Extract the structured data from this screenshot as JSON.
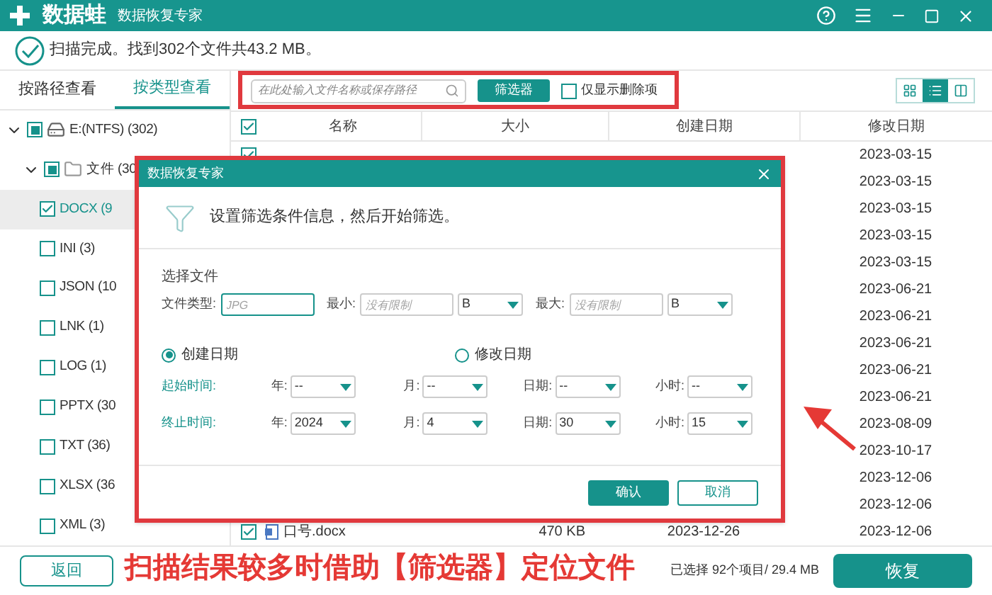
{
  "window": {
    "logo": "数据蛙",
    "subtitle": "数据恢复专家"
  },
  "status": "扫描完成。找到302个文件共43.2 MB。",
  "view_tabs": [
    {
      "label": "按路径查看",
      "selected": false
    },
    {
      "label": "按类型查看",
      "selected": true
    }
  ],
  "tree": [
    {
      "label": "E:(NTFS) (302)",
      "kind": "drive",
      "expanded": true,
      "checked": true,
      "partial": true,
      "selected": false,
      "children": [
        {
          "label": "文件 (30",
          "kind": "folder",
          "expanded": true,
          "checked": true,
          "partial": true,
          "selected": false,
          "children": [
            {
              "label": "DOCX (9",
              "kind": "type",
              "checked": true,
              "partial": false,
              "selected": true
            },
            {
              "label": "INI (3)",
              "kind": "type",
              "checked": false,
              "partial": false,
              "selected": false
            },
            {
              "label": "JSON (10",
              "kind": "type",
              "checked": false,
              "partial": false,
              "selected": false
            },
            {
              "label": "LNK (1)",
              "kind": "type",
              "checked": false,
              "partial": false,
              "selected": false
            },
            {
              "label": "LOG (1)",
              "kind": "type",
              "checked": false,
              "partial": false,
              "selected": false
            },
            {
              "label": "PPTX (30",
              "kind": "type",
              "checked": false,
              "partial": false,
              "selected": false
            },
            {
              "label": "TXT (36)",
              "kind": "type",
              "checked": false,
              "partial": false,
              "selected": false
            },
            {
              "label": "XLSX (36",
              "kind": "type",
              "checked": false,
              "partial": false,
              "selected": false
            },
            {
              "label": "XML (3)",
              "kind": "type",
              "checked": false,
              "partial": false,
              "selected": false
            }
          ]
        }
      ]
    }
  ],
  "toolbar": {
    "search": {
      "placeholder": "在此处输入文件名称或保存路径"
    },
    "filter_button": "筛选器",
    "deleted_only": {
      "label": "仅显示删除项",
      "checked": false
    },
    "views": [
      {
        "kind": "grid",
        "selected": false
      },
      {
        "kind": "list",
        "selected": true
      },
      {
        "kind": "columns",
        "selected": false
      }
    ]
  },
  "table": {
    "all_checked": true,
    "columns": [
      "名称",
      "大小",
      "创建日期",
      "修改日期"
    ],
    "rows": [
      {
        "checked": true,
        "modified": "2023-03-15"
      },
      {
        "modified": "2023-03-15"
      },
      {
        "modified": "2023-03-15"
      },
      {
        "modified": "2023-03-15"
      },
      {
        "modified": "2023-03-15"
      },
      {
        "modified": "2023-06-21"
      },
      {
        "modified": "2023-06-21"
      },
      {
        "modified": "2023-06-21"
      },
      {
        "modified": "2023-06-21"
      },
      {
        "modified": "2023-06-21"
      },
      {
        "modified": "2023-08-09"
      },
      {
        "modified": "2023-10-17"
      },
      {
        "modified": "2023-12-06"
      },
      {
        "modified": "2023-12-06"
      },
      {
        "checked": true,
        "name": "口号.docx",
        "size": "470 KB",
        "created": "2023-12-26",
        "modified": "2023-12-06"
      }
    ]
  },
  "dialog": {
    "title": "数据恢复专家",
    "message": "设置筛选条件信息，然后开始筛选。",
    "section": "选择文件",
    "file_type": {
      "label": "文件类型:",
      "placeholder": "JPG"
    },
    "min": {
      "label": "最小:",
      "placeholder": "没有限制",
      "unit": "B"
    },
    "max": {
      "label": "最大:",
      "placeholder": "没有限制",
      "unit": "B"
    },
    "date_kinds": [
      {
        "label": "创建日期",
        "selected": true
      },
      {
        "label": "修改日期",
        "selected": false
      }
    ],
    "ranges": [
      {
        "label": "起始时间:",
        "fields": [
          {
            "label": "年:",
            "value": "--"
          },
          {
            "label": "月:",
            "value": "--"
          },
          {
            "label": "日期:",
            "value": "--"
          },
          {
            "label": "小时:",
            "value": "--"
          }
        ]
      },
      {
        "label": "终止时间:",
        "fields": [
          {
            "label": "年:",
            "value": "2024"
          },
          {
            "label": "月:",
            "value": "4"
          },
          {
            "label": "日期:",
            "value": "30"
          },
          {
            "label": "小时:",
            "value": "15"
          }
        ]
      }
    ],
    "buttons": [
      {
        "label": "确认",
        "kind": "primary"
      },
      {
        "label": "取消",
        "kind": "secondary"
      }
    ]
  },
  "footer": {
    "back_button": "返回",
    "selection": "已选择 92个项目/ 29.4 MB",
    "recover_button": "恢复"
  },
  "annotation": {
    "caption": "扫描结果较多时借助【筛选器】定位文件"
  }
}
